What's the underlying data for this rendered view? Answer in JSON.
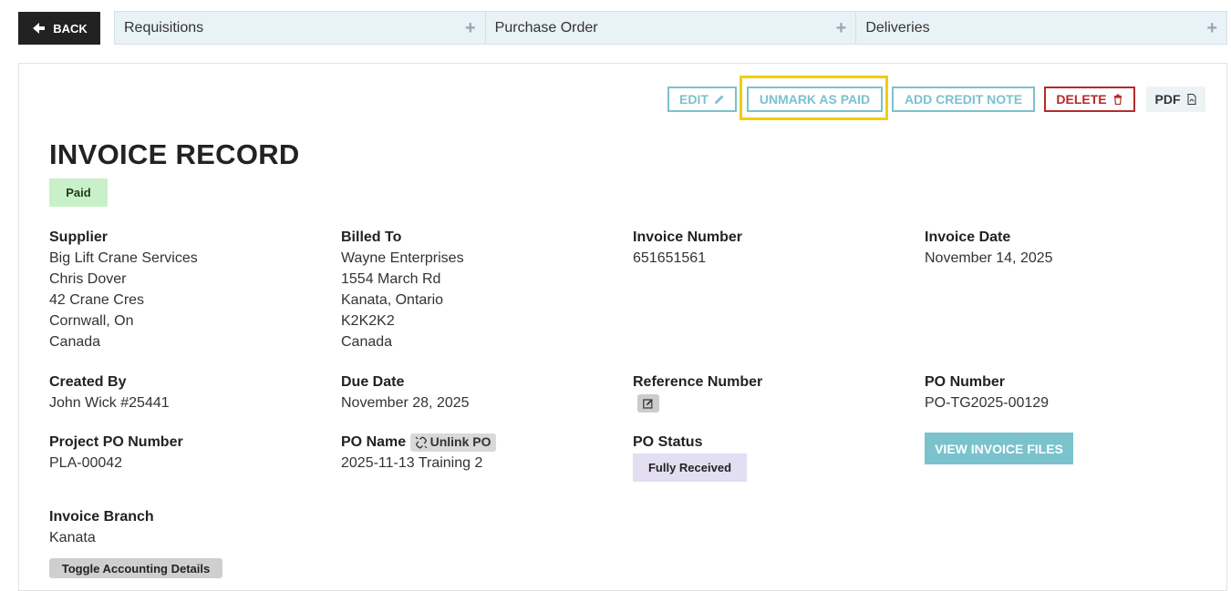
{
  "nav": {
    "back_label": "BACK",
    "tabs": [
      {
        "label": "Requisitions"
      },
      {
        "label": "Purchase Order"
      },
      {
        "label": "Deliveries"
      }
    ]
  },
  "actions": {
    "edit": "EDIT",
    "unmark": "UNMARK AS PAID",
    "credit": "ADD CREDIT NOTE",
    "delete": "DELETE",
    "pdf": "PDF"
  },
  "title": "INVOICE RECORD",
  "status_badge": "Paid",
  "supplier": {
    "label": "Supplier",
    "lines": [
      "Big Lift Crane Services",
      "Chris Dover",
      "42 Crane Cres",
      "Cornwall, On",
      "Canada"
    ]
  },
  "billed_to": {
    "label": "Billed To",
    "lines": [
      "Wayne Enterprises",
      "1554 March Rd",
      "Kanata, Ontario",
      "K2K2K2",
      "Canada"
    ]
  },
  "invoice_number": {
    "label": "Invoice Number",
    "value": "651651561"
  },
  "invoice_date": {
    "label": "Invoice Date",
    "value": "November 14, 2025"
  },
  "created_by": {
    "label": "Created By",
    "value": "John Wick #25441"
  },
  "due_date": {
    "label": "Due Date",
    "value": "November 28, 2025"
  },
  "reference_number": {
    "label": "Reference Number"
  },
  "po_number": {
    "label": "PO Number",
    "value": "PO-TG2025-00129"
  },
  "project_po": {
    "label": "Project PO Number",
    "value": "PLA-00042"
  },
  "po_name": {
    "label": "PO Name",
    "unlink_label": "Unlink PO",
    "value": "2025-11-13 Training 2"
  },
  "po_status": {
    "label": "PO Status",
    "value": "Fully Received"
  },
  "view_files": "VIEW INVOICE FILES",
  "invoice_branch": {
    "label": "Invoice Branch",
    "value": "Kanata"
  },
  "toggle_accounting": "Toggle Accounting Details",
  "colors": {
    "accent": "#7ac2cc",
    "danger": "#b52a2a",
    "highlight": "#f2cc0f",
    "paid_badge": "#c9f1c9",
    "status_badge": "#e3def2"
  }
}
